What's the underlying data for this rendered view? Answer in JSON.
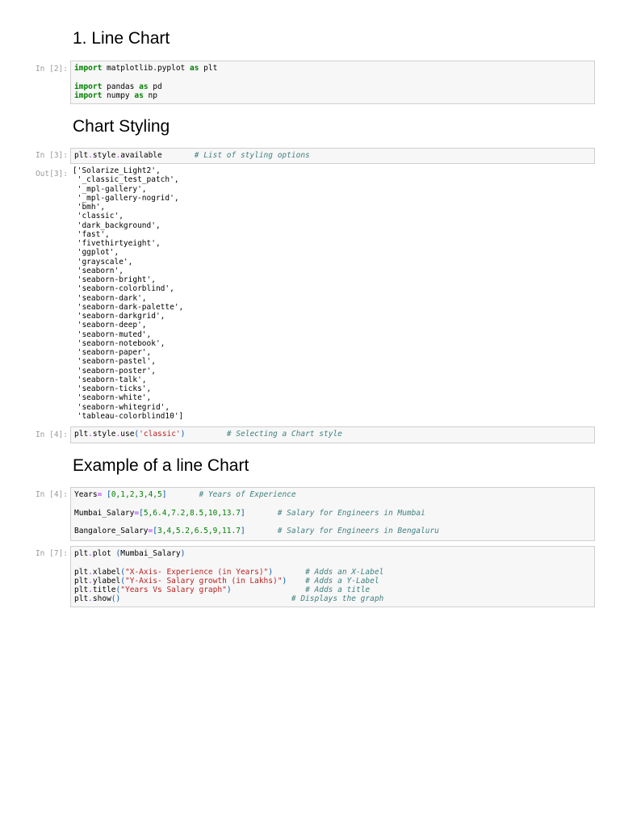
{
  "headings": {
    "line_chart": "1. Line Chart",
    "chart_styling": "Chart Styling",
    "example": "Example of a line Chart"
  },
  "cells": [
    {
      "prompt": "In [2]:",
      "lines": [
        [
          [
            "import",
            "kw"
          ],
          [
            " matplotlib.pyplot ",
            ""
          ],
          [
            "as",
            "kw"
          ],
          [
            " plt",
            ""
          ]
        ],
        [],
        [
          [
            "import",
            "kw"
          ],
          [
            " pandas ",
            ""
          ],
          [
            "as",
            "kw"
          ],
          [
            " pd",
            ""
          ]
        ],
        [
          [
            "import",
            "kw"
          ],
          [
            " numpy ",
            ""
          ],
          [
            "as",
            "kw"
          ],
          [
            " np",
            ""
          ]
        ]
      ]
    },
    {
      "prompt": "In [3]:",
      "lines": [
        [
          [
            "plt",
            ""
          ],
          [
            ".",
            "op"
          ],
          [
            "style",
            ""
          ],
          [
            ".",
            "op"
          ],
          [
            "available       ",
            ""
          ],
          [
            "# List of styling options",
            "cm"
          ]
        ]
      ]
    },
    {
      "prompt": "In [4]:",
      "lines": [
        [
          [
            "plt",
            ""
          ],
          [
            ".",
            "op"
          ],
          [
            "style",
            ""
          ],
          [
            ".",
            "op"
          ],
          [
            "use",
            ""
          ],
          [
            "(",
            "br"
          ],
          [
            "'classic'",
            "str"
          ],
          [
            ")",
            "br"
          ],
          [
            "         ",
            ""
          ],
          [
            "# Selecting a Chart style",
            "cm"
          ]
        ]
      ]
    },
    {
      "prompt": "In [4]:",
      "lines": [
        [
          [
            "Years",
            ""
          ],
          [
            "=",
            "op"
          ],
          [
            " ",
            ""
          ],
          [
            "[",
            "br"
          ],
          [
            "0,1,2,3,4,5",
            "num"
          ],
          [
            "]",
            "br"
          ],
          [
            "       ",
            ""
          ],
          [
            "# Years of Experience",
            "cm"
          ]
        ],
        [],
        [
          [
            "Mumbai_Salary",
            ""
          ],
          [
            "=",
            "op"
          ],
          [
            "[",
            "br"
          ],
          [
            "5,6.4,7.2,8.5,10,13.7",
            "num"
          ],
          [
            "]",
            "br"
          ],
          [
            "       ",
            ""
          ],
          [
            "# Salary for Engineers in Mumbai",
            "cm"
          ]
        ],
        [],
        [
          [
            "Bangalore_Salary",
            ""
          ],
          [
            "=",
            "op"
          ],
          [
            "[",
            "br"
          ],
          [
            "3,4,5.2,6.5,9,11.7",
            "num"
          ],
          [
            "]",
            "br"
          ],
          [
            "       ",
            ""
          ],
          [
            "# Salary for Engineers in Bengaluru",
            "cm"
          ]
        ]
      ]
    },
    {
      "prompt": "In [7]:",
      "lines": [
        [
          [
            "plt",
            ""
          ],
          [
            ".",
            "op"
          ],
          [
            "plot ",
            ""
          ],
          [
            "(",
            "br"
          ],
          [
            "Mumbai_Salary",
            ""
          ],
          [
            ")",
            "br"
          ]
        ],
        [],
        [
          [
            "plt",
            ""
          ],
          [
            ".",
            "op"
          ],
          [
            "xlabel",
            ""
          ],
          [
            "(",
            "br"
          ],
          [
            "\"X-Axis- Experience (in Years)\"",
            "str"
          ],
          [
            ")",
            "br"
          ],
          [
            "       ",
            ""
          ],
          [
            "# Adds an X-Label",
            "cm"
          ]
        ],
        [
          [
            "plt",
            ""
          ],
          [
            ".",
            "op"
          ],
          [
            "ylabel",
            ""
          ],
          [
            "(",
            "br"
          ],
          [
            "\"Y-Axis- Salary growth (in Lakhs)\"",
            "str"
          ],
          [
            ")",
            "br"
          ],
          [
            "    ",
            ""
          ],
          [
            "# Adds a Y-Label",
            "cm"
          ]
        ],
        [
          [
            "plt",
            ""
          ],
          [
            ".",
            "op"
          ],
          [
            "title",
            ""
          ],
          [
            "(",
            "br"
          ],
          [
            "\"Years Vs Salary graph\"",
            "str"
          ],
          [
            ")",
            "br"
          ],
          [
            "                ",
            ""
          ],
          [
            "# Adds a title",
            "cm"
          ]
        ],
        [
          [
            "plt",
            ""
          ],
          [
            ".",
            "op"
          ],
          [
            "show",
            ""
          ],
          [
            "()",
            "br"
          ],
          [
            "                                     ",
            ""
          ],
          [
            "# Displays the graph",
            "cm"
          ]
        ]
      ]
    }
  ],
  "output": {
    "prompt": "Out[3]:",
    "lines": [
      "['Solarize_Light2',",
      " '_classic_test_patch',",
      " '_mpl-gallery',",
      " '_mpl-gallery-nogrid',",
      " 'bmh',",
      " 'classic',",
      " 'dark_background',",
      " 'fast',",
      " 'fivethirtyeight',",
      " 'ggplot',",
      " 'grayscale',",
      " 'seaborn',",
      " 'seaborn-bright',",
      " 'seaborn-colorblind',",
      " 'seaborn-dark',",
      " 'seaborn-dark-palette',",
      " 'seaborn-darkgrid',",
      " 'seaborn-deep',",
      " 'seaborn-muted',",
      " 'seaborn-notebook',",
      " 'seaborn-paper',",
      " 'seaborn-pastel',",
      " 'seaborn-poster',",
      " 'seaborn-talk',",
      " 'seaborn-ticks',",
      " 'seaborn-white',",
      " 'seaborn-whitegrid',",
      " 'tableau-colorblind10']"
    ]
  }
}
